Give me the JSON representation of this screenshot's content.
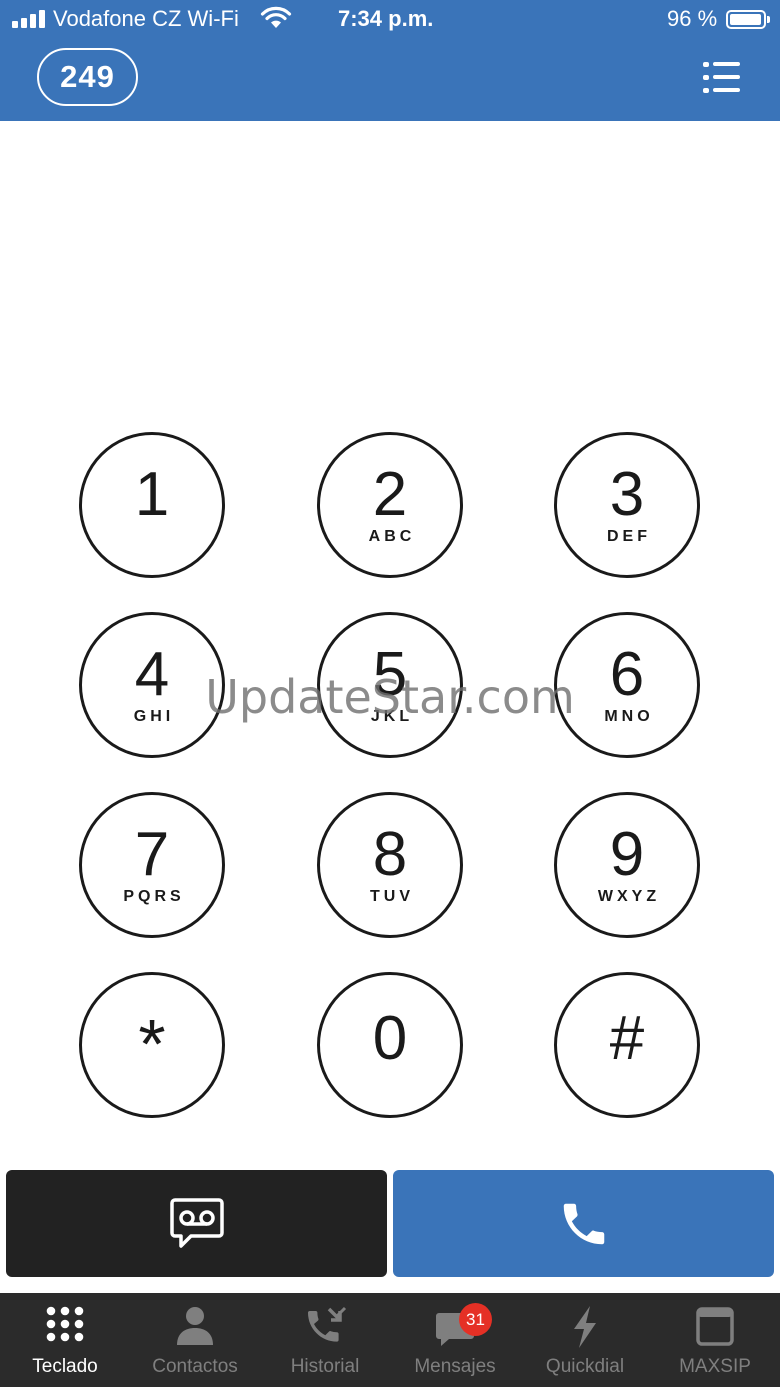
{
  "status_bar": {
    "carrier": "Vodafone CZ Wi-Fi",
    "time": "7:34 p.m.",
    "battery_percent": "96 %",
    "battery_level": 0.96
  },
  "header": {
    "account_number": "249",
    "menu_icon": "list-menu-icon"
  },
  "keypad": {
    "keys": [
      {
        "digit": "1",
        "letters": ""
      },
      {
        "digit": "2",
        "letters": "ABC"
      },
      {
        "digit": "3",
        "letters": "DEF"
      },
      {
        "digit": "4",
        "letters": "GHI"
      },
      {
        "digit": "5",
        "letters": "JKL"
      },
      {
        "digit": "6",
        "letters": "MNO"
      },
      {
        "digit": "7",
        "letters": "PQRS"
      },
      {
        "digit": "8",
        "letters": "TUV"
      },
      {
        "digit": "9",
        "letters": "WXYZ"
      },
      {
        "digit": "*",
        "letters": ""
      },
      {
        "digit": "0",
        "letters": ""
      },
      {
        "digit": "#",
        "letters": ""
      }
    ]
  },
  "watermark": "UpdateStar.com",
  "actions": {
    "voicemail_icon": "voicemail-icon",
    "call_icon": "phone-icon"
  },
  "tabs": [
    {
      "label": "Teclado",
      "icon": "keypad-icon",
      "active": true
    },
    {
      "label": "Contactos",
      "icon": "person-icon",
      "active": false
    },
    {
      "label": "Historial",
      "icon": "call-history-icon",
      "active": false
    },
    {
      "label": "Mensajes",
      "icon": "chat-bubble-icon",
      "active": false,
      "badge": "31"
    },
    {
      "label": "Quickdial",
      "icon": "lightning-icon",
      "active": false
    },
    {
      "label": "MAXSIP",
      "icon": "window-icon",
      "active": false
    }
  ],
  "colors": {
    "header_blue": "#3a74b9",
    "tab_bar": "#2b2b2b",
    "voicemail_button": "#222222",
    "badge_red": "#e53025"
  }
}
